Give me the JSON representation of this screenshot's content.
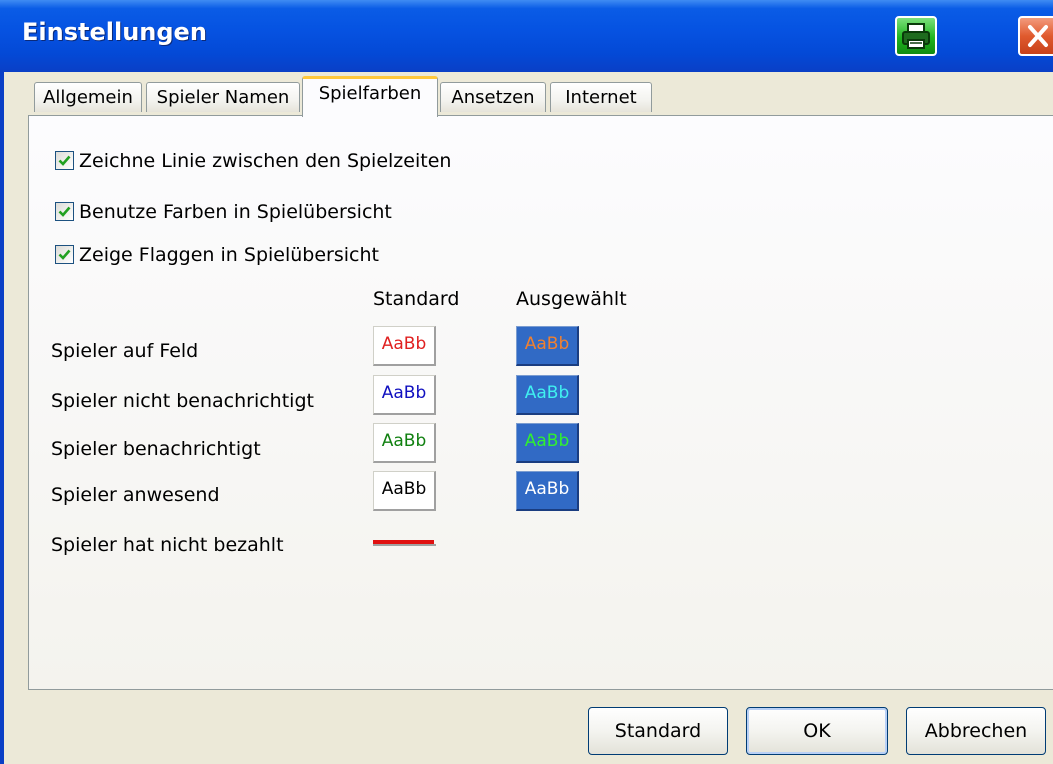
{
  "window": {
    "title": "Einstellungen",
    "title_icons": [
      "printer-icon",
      "close-icon"
    ]
  },
  "tabs": [
    {
      "label": "Allgemein",
      "active": false
    },
    {
      "label": "Spieler Namen",
      "active": false
    },
    {
      "label": "Spielfarben",
      "active": true
    },
    {
      "label": "Ansetzen",
      "active": false
    },
    {
      "label": "Internet",
      "active": false
    }
  ],
  "options": [
    {
      "label": "Zeichne Linie zwischen den Spielzeiten",
      "checked": true
    },
    {
      "label": "Benutze Farben in Spielübersicht",
      "checked": true
    },
    {
      "label": "Zeige Flaggen in Spielübersicht",
      "checked": true
    }
  ],
  "columns": {
    "standard": "Standard",
    "selected": "Ausgewählt"
  },
  "color_rows": [
    {
      "label": "Spieler auf Feld",
      "sample": "AaBb",
      "standard_color": "#E02020",
      "selected_color": "#F08030"
    },
    {
      "label": "Spieler nicht benachrichtigt",
      "sample": "AaBb",
      "standard_color": "#1010C0",
      "selected_color": "#40F0F0"
    },
    {
      "label": "Spieler benachrichtigt",
      "sample": "AaBb",
      "standard_color": "#108010",
      "selected_color": "#30F030"
    },
    {
      "label": "Spieler anwesend",
      "sample": "AaBb",
      "standard_color": "#000000",
      "selected_color": "#FFFFFF"
    }
  ],
  "unpaid": {
    "label": "Spieler hat nicht bezahlt",
    "line_color": "#E01010"
  },
  "selected_background": "#316AC5",
  "buttons": {
    "standard": "Standard",
    "ok": "OK",
    "cancel": "Abbrechen"
  }
}
